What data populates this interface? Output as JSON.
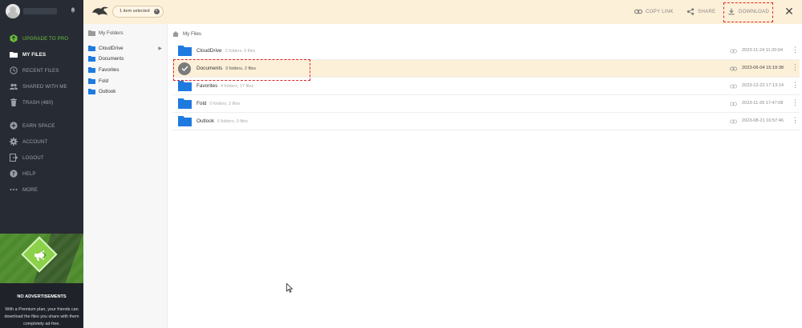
{
  "sidebar": {
    "nav": [
      {
        "label": "UPGRADE TO PRO",
        "icon": "pro-icon"
      },
      {
        "label": "MY FILES",
        "icon": "folder-icon"
      },
      {
        "label": "RECENT FILES",
        "icon": "clock-icon"
      },
      {
        "label": "SHARED WITH ME",
        "icon": "users-icon"
      },
      {
        "label": "TRASH (480)",
        "icon": "trash-icon"
      },
      {
        "label": "EARN SPACE",
        "icon": "plus-circle-icon"
      },
      {
        "label": "ACCOUNT",
        "icon": "gear-icon"
      },
      {
        "label": "LOGOUT",
        "icon": "logout-icon"
      },
      {
        "label": "HELP",
        "icon": "help-icon"
      },
      {
        "label": "MORE",
        "icon": "more-icon"
      }
    ],
    "promo": {
      "title": "NO ADVERTISEMENTS",
      "text": "With a Premium plan, your friends can download the files you share with them completely ad-free."
    }
  },
  "topbar": {
    "selected_label": "1 item selected",
    "copy_link": "COPY LINK",
    "share": "SHARE",
    "download": "DOWNLOAD"
  },
  "tree": {
    "root": "My Folders",
    "items": [
      "CloudDrive",
      "Documents",
      "Favorites",
      "Fold",
      "Outlook"
    ]
  },
  "breadcrumb": "My Files",
  "files": [
    {
      "name": "CloudDrive",
      "meta": "2 folders, 6 files",
      "date": "2023-11-24 11:20:04",
      "selected": false
    },
    {
      "name": "Documents",
      "meta": "0 folders, 2 files",
      "date": "2023-06-04 15:19:38",
      "selected": true
    },
    {
      "name": "Favorites",
      "meta": "4 folders, 17 files",
      "date": "2023-12-22 17:13:14",
      "selected": false
    },
    {
      "name": "Fold",
      "meta": "0 folders, 2 files",
      "date": "2023-11-20 17:47:08",
      "selected": false
    },
    {
      "name": "Outlook",
      "meta": "6 folders, 0 files",
      "date": "2023-08-21 16:57:46",
      "selected": false
    }
  ],
  "colors": {
    "sidebar_bg": "#272c34",
    "accent_green": "#6bbf3a",
    "topbar_bg": "#fdf0d8",
    "folder_blue": "#1f7ae0",
    "highlight_red": "#e02424"
  }
}
